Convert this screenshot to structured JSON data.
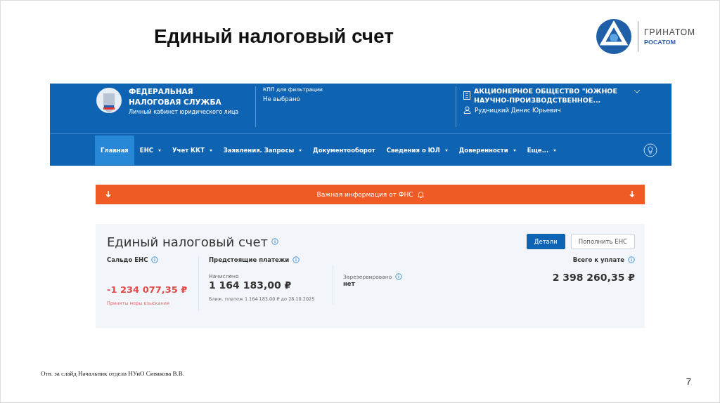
{
  "slide": {
    "title": "Единый налоговый счет",
    "page_number": "7",
    "footer": "Отв. за слайд Начальник отдела НУиО Сивакова В.В."
  },
  "logo": {
    "name": "ГРИНАТОМ",
    "subname": "РОСАТОМ"
  },
  "header": {
    "org_line1": "ФЕДЕРАЛЬНАЯ",
    "org_line2": "НАЛОГОВАЯ СЛУЖБА",
    "subtitle": "Личный кабинет юридического лица",
    "kpp_label": "КПП для фильтрации",
    "kpp_value": "Не выбрано",
    "company_line1": "АКЦИОНЕРНОЕ ОБЩЕСТВО \"ЮЖНОЕ",
    "company_line2": "НАУЧНО-ПРОИЗВОДСТВЕННОЕ...",
    "user": "Рудницкий Денис Юрьевич"
  },
  "nav": [
    {
      "label": "Главная",
      "selected": true,
      "dropdown": false
    },
    {
      "label": "ЕНС",
      "selected": false,
      "dropdown": true
    },
    {
      "label": "Учет ККТ",
      "selected": false,
      "dropdown": true
    },
    {
      "label": "Заявления. Запросы",
      "selected": false,
      "dropdown": true
    },
    {
      "label": "Документооборот",
      "selected": false,
      "dropdown": false
    },
    {
      "label": "Сведения о ЮЛ",
      "selected": false,
      "dropdown": true
    },
    {
      "label": "Доверенности",
      "selected": false,
      "dropdown": true
    },
    {
      "label": "Еще...",
      "selected": false,
      "dropdown": true
    }
  ],
  "notice": {
    "text": "Важная информация от ФНС"
  },
  "account": {
    "title": "Единый налоговый счет",
    "buttons": [
      {
        "label": "Детали",
        "kind": "primary"
      },
      {
        "label": "Пополнить ЕНС",
        "kind": "secondary"
      }
    ],
    "balance_label": "Сальдо ЕНС",
    "balance": "-1 234 077,35 ₽",
    "balance_note": "Приняты меры взыскания",
    "upcoming_label": "Предстоящие платежи",
    "accrued_label": "Начислено",
    "accrued": "1 164 183,00 ₽",
    "next_payment": "Ближ. платеж 1 164 183,00 ₽ до 28.10.2025",
    "reserved_label": "Зарезервировано",
    "reserved": "нет",
    "total_label": "Всего к уплате",
    "total": "2 398 260,35 ₽"
  }
}
